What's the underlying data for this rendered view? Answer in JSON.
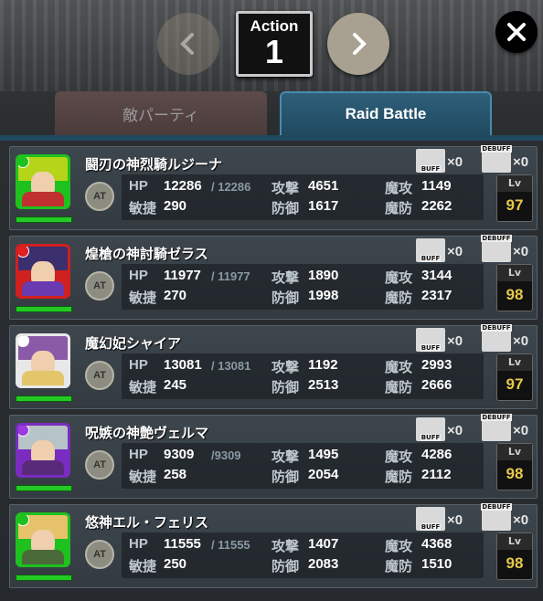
{
  "header": {
    "action_label": "Action",
    "action_number": "1"
  },
  "tabs": {
    "enemy_party": "敵パーティ",
    "raid_battle": "Raid Battle"
  },
  "labels": {
    "hp": "HP",
    "atk": "攻撃",
    "matk": "魔攻",
    "agi": "敏捷",
    "def": "防御",
    "mdef": "魔防",
    "lv": "Lv",
    "at": "AT",
    "buff": "BUFF",
    "debuff": "DEBUFF",
    "x": "×"
  },
  "units": [
    {
      "name": "闘刃の神烈騎ルジーナ",
      "hp": "12286",
      "hp_max": "/ 12286",
      "atk": "4651",
      "matk": "1149",
      "agi": "290",
      "def": "1617",
      "mdef": "2262",
      "lv": "97",
      "buff": "0",
      "debuff": "0",
      "frame": "#1ec11e",
      "hair": "#b6d41a",
      "body": "#c03030",
      "element": "#1ec11e"
    },
    {
      "name": "煌槍の神討騎ゼラス",
      "hp": "11977",
      "hp_max": "/ 11977",
      "atk": "1890",
      "matk": "3144",
      "agi": "270",
      "def": "1998",
      "mdef": "2317",
      "lv": "98",
      "buff": "0",
      "debuff": "0",
      "frame": "#d02020",
      "hair": "#3b2f6e",
      "body": "#6a3ab0",
      "element": "#e02020"
    },
    {
      "name": "魔幻妃シャイア",
      "hp": "13081",
      "hp_max": "/ 13081",
      "atk": "1192",
      "matk": "2993",
      "agi": "245",
      "def": "2513",
      "mdef": "2666",
      "lv": "97",
      "buff": "0",
      "debuff": "0",
      "frame": "#e8e8e8",
      "hair": "#8a5aa8",
      "body": "#e3c66a",
      "element": "#ffffff"
    },
    {
      "name": "呪嫉の神艶ヴェルマ",
      "hp": "9309",
      "hp_max": "/9309",
      "atk": "1495",
      "matk": "4286",
      "agi": "258",
      "def": "2054",
      "mdef": "2112",
      "lv": "98",
      "buff": "0",
      "debuff": "0",
      "frame": "#7a2cc0",
      "hair": "#b6c3c7",
      "body": "#5a2a7a",
      "element": "#9a3ae0"
    },
    {
      "name": "悠神エル・フェリス",
      "hp": "11555",
      "hp_max": "/ 11555",
      "atk": "1407",
      "matk": "4368",
      "agi": "250",
      "def": "2083",
      "mdef": "1510",
      "lv": "98",
      "buff": "0",
      "debuff": "0",
      "frame": "#1ec11e",
      "hair": "#e6c26a",
      "body": "#4a6a3a",
      "element": "#1ec11e"
    }
  ]
}
